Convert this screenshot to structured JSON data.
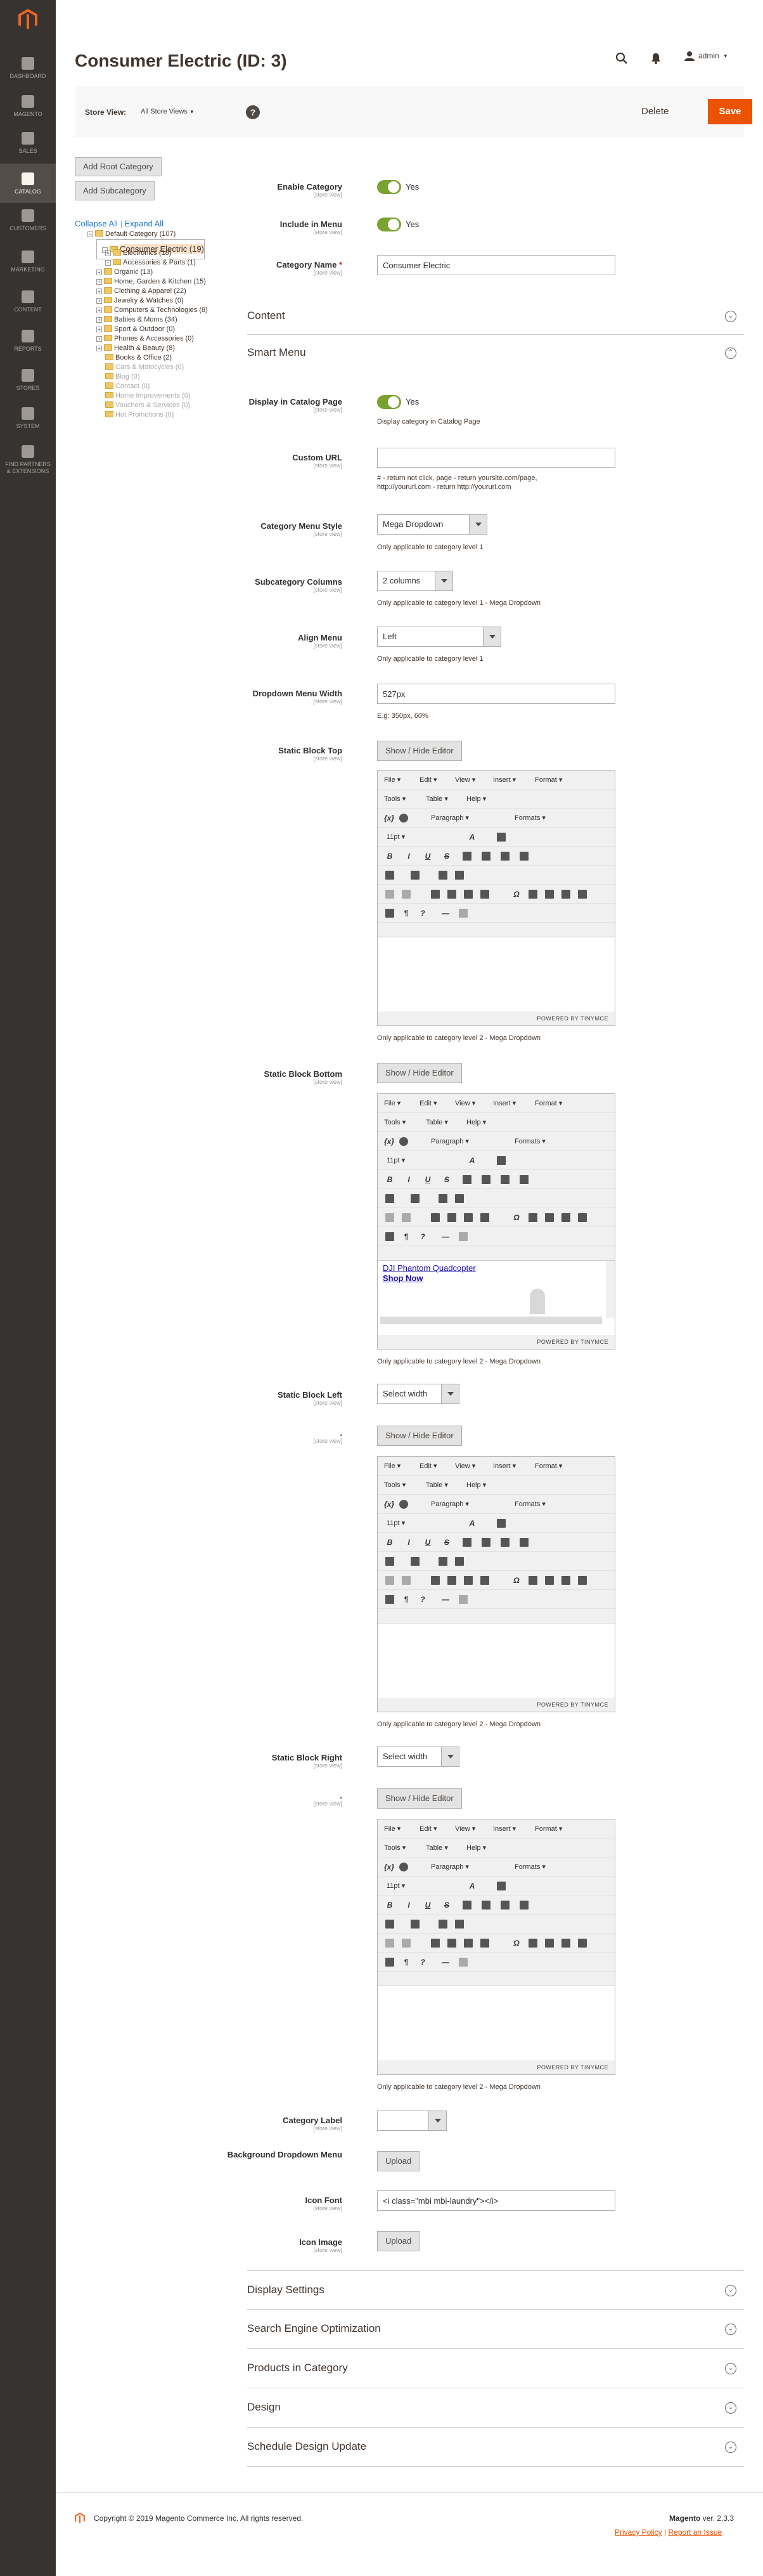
{
  "sidebar": {
    "items": [
      {
        "label": "Dashboard",
        "icon": "dashboard-icon"
      },
      {
        "label": "Magento",
        "icon": "magento-icon"
      },
      {
        "label": "Sales",
        "icon": "dollar-icon"
      },
      {
        "label": "Catalog",
        "icon": "cube-icon",
        "active": true
      },
      {
        "label": "Customers",
        "icon": "customers-icon"
      },
      {
        "label": "Marketing",
        "icon": "megaphone-icon"
      },
      {
        "label": "Content",
        "icon": "content-icon"
      },
      {
        "label": "Reports",
        "icon": "bar-chart-icon"
      },
      {
        "label": "Stores",
        "icon": "store-icon"
      },
      {
        "label": "System",
        "icon": "gear-icon"
      },
      {
        "label": "Find Partners & Extensions",
        "icon": "partners-icon"
      }
    ]
  },
  "header": {
    "title": "Consumer Electric (ID: 3)",
    "user": "admin"
  },
  "store_view": {
    "label": "Store View:",
    "value": "All Store Views",
    "help": "?",
    "delete_label": "Delete",
    "save_label": "Save"
  },
  "tree": {
    "add_root_label": "Add Root Category",
    "add_sub_label": "Add Subcategory",
    "collapse_label": "Collapse All",
    "separator": "|",
    "expand_label": "Expand All",
    "nodes": [
      {
        "label": "Default Category (107)"
      },
      {
        "label": "Consumer Electric (19)"
      },
      {
        "label": "Electronics (18)"
      },
      {
        "label": "Accessories & Parts (1)"
      },
      {
        "label": "Organic (13)"
      },
      {
        "label": "Home, Garden & Kitchen (15)"
      },
      {
        "label": "Clothing & Apparel (22)"
      },
      {
        "label": "Jewelry & Watches (0)"
      },
      {
        "label": "Computers & Technologies (8)"
      },
      {
        "label": "Babies & Moms (34)"
      },
      {
        "label": "Sport & Outdoor (0)"
      },
      {
        "label": "Phones & Accessories (0)"
      },
      {
        "label": "Health & Beauty (8)"
      },
      {
        "label": "Books & Office (2)"
      },
      {
        "label": "Cars & Motocycles (0)"
      },
      {
        "label": "Blog (0)"
      },
      {
        "label": "Contact (0)"
      },
      {
        "label": "Home Improvements (0)"
      },
      {
        "label": "Vouchers & Services (0)"
      },
      {
        "label": "Hot Promotions (0)"
      }
    ]
  },
  "form": {
    "scope": "[store view]",
    "required_mark": "*",
    "enable_label": "Enable Category",
    "enable_value": "Yes",
    "include_label": "Include in Menu",
    "include_value": "Yes",
    "name_label": "Category Name",
    "name_value": "Consumer Electric",
    "content_title": "Content",
    "smart_menu_title": "Smart Menu",
    "display_catalog_label": "Display in Catalog Page",
    "display_catalog_value": "Yes",
    "display_catalog_note": "Display category in Catalog Page",
    "custom_url_label": "Custom URL",
    "custom_url_value": "",
    "custom_url_note_1": "# - return not click, page - return yoursite.com/page,",
    "custom_url_note_2": "http://yoururl.com - return http://yoururl.com",
    "menu_style_label": "Category Menu Style",
    "menu_style_value": "Mega Dropdown",
    "menu_style_note": "Only applicable to category level 1",
    "sub_columns_label": "Subcategory Columns",
    "sub_columns_value": "2 columns",
    "sub_columns_note": "Only applicable to category level 1 - Mega Dropdown",
    "align_label": "Align Menu",
    "align_value": "Left",
    "align_note": "Only applicable to category level 1",
    "width_label": "Dropdown Menu Width",
    "width_value": "527px",
    "width_note": "E.g: 350px, 60%",
    "static_top_label": "Static Block Top",
    "static_bottom_label": "Static Block Bottom",
    "static_left_label": "Static Block Left",
    "static_right_label": "Static Block Right",
    "dot_label": ".",
    "select_width": "Select width",
    "show_hide": "Show / Hide Editor",
    "level2_note": "Only applicable to category level 2 - Mega Dropdown",
    "category_label_label": "Category Label",
    "category_label_value": "",
    "bg_dropdown_label": "Background Dropdown Menu",
    "upload": "Upload",
    "icon_font_label": "Icon Font",
    "icon_font_value": "<i class=\"mbi mbi-laundry\"></i>",
    "icon_image_label": "Icon Image"
  },
  "editor": {
    "menu_file": "File ▾",
    "menu_edit": "Edit ▾",
    "menu_view": "View ▾",
    "menu_insert": "Insert ▾",
    "menu_format": "Format ▾",
    "menu_tools": "Tools ▾",
    "menu_table": "Table ▾",
    "menu_help": "Help ▾",
    "paragraph": "Paragraph ▾",
    "formats": "Formats ▾",
    "font_size": "11pt ▾",
    "status": "POWERED BY TINYMCE",
    "bottom_link": "DJI Phantom Quadcopter",
    "bottom_shop": "Shop Now"
  },
  "sections": {
    "display_settings": "Display Settings",
    "seo": "Search Engine Optimization",
    "products": "Products in Category",
    "design": "Design",
    "schedule": "Schedule Design Update"
  },
  "footer": {
    "copyright": "Copyright © 2019 Magento Commerce Inc. All rights reserved.",
    "brand": "Magento",
    "version": "ver. 2.3.3",
    "privacy": "Privacy Policy",
    "report": "Report an Issue"
  },
  "colors": {
    "accent": "#eb5202",
    "sidebar": "#373330",
    "toggle_on": "#79a22e",
    "link": "#1979c3"
  }
}
